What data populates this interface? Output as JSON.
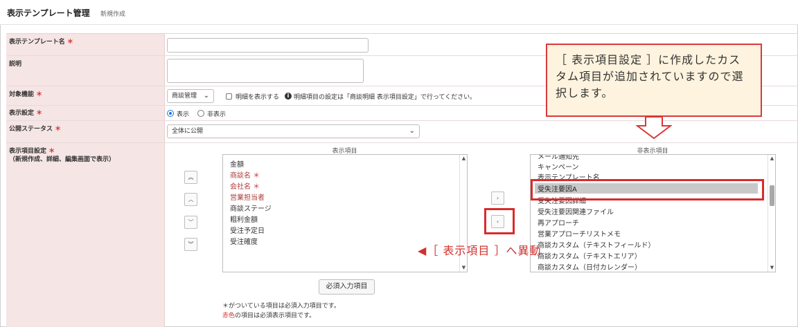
{
  "header": {
    "title": "表示テンプレート管理",
    "subtitle": "新規作成"
  },
  "form": {
    "template_name": {
      "label": "表示テンプレート名",
      "req": "＊",
      "value": ""
    },
    "description": {
      "label": "説明",
      "value": ""
    },
    "target": {
      "label": "対象機能",
      "req": "＊",
      "select_value": "商談管理",
      "checkbox_label": "明細を表示する",
      "info_text": "明細項目の設定は「商談明細 表示項目設定」で行ってください。"
    },
    "display": {
      "label": "表示設定",
      "req": "＊",
      "opt_show": "表示",
      "opt_hide": "非表示"
    },
    "public_status": {
      "label": "公開ステータス",
      "req": "＊",
      "select_value": "全体に公開"
    },
    "items": {
      "label": "表示項目設定",
      "req": "＊",
      "label_sub": "（新規作成、詳細、編集画面で表示）",
      "shown_header": "表示項目",
      "hidden_header": "非表示項目",
      "shown_items": [
        {
          "text": "金額",
          "red": false
        },
        {
          "text": "商談名 ＊",
          "red": true
        },
        {
          "text": "会社名 ＊",
          "red": true
        },
        {
          "text": "営業担当者",
          "red": true
        },
        {
          "text": "商談ステージ",
          "red": false
        },
        {
          "text": "粗利金額",
          "red": false
        },
        {
          "text": "受注予定日",
          "red": false
        },
        {
          "text": "受注確度",
          "red": false
        }
      ],
      "hidden_items": [
        "メール通知先",
        "キャンペーン",
        "表示テンプレート名",
        "受失注要因A",
        "受失注要因詳細",
        "受失注要因関連ファイル",
        "再アプローチ",
        "営業アプローチリストメモ",
        "商談カスタム（テキストフィールド）",
        "商談カスタム（テキストエリア）",
        "商談カスタム（日付カレンダー）"
      ],
      "selected_hidden_index": 3,
      "required_button": "必須入力項目",
      "note1": "＊がついている項目は必須入力項目です。",
      "note2_red": "赤色",
      "note2_rest": "の項目は必須表示項目です。",
      "icons": [
        "double-up-icon",
        "up-icon",
        "down-icon",
        "double-down-icon",
        "move-right-icon",
        "move-left-icon"
      ]
    }
  },
  "annotations": {
    "callout_text": "［ 表示項目設定 ］に作成したカスタム項目が追加されていますので選択します。",
    "move_note": "◀［ 表示項目 ］へ異動"
  },
  "colors": {
    "required": "#d0312d",
    "label_bg": "#f6e5e5",
    "callout_bg": "#fdf3de",
    "highlight": "#d92b2b"
  }
}
